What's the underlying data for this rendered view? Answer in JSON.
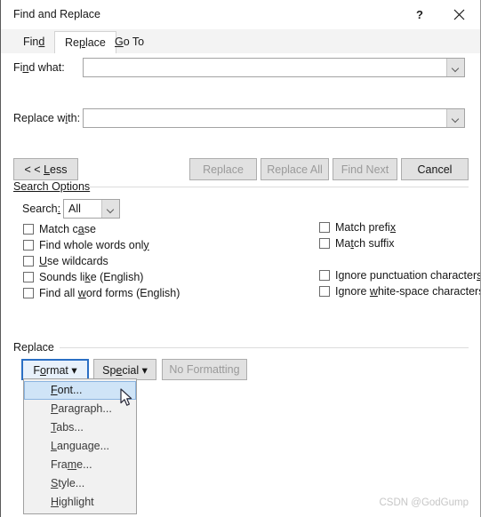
{
  "window": {
    "title": "Find and Replace",
    "help_label": "?",
    "close_label": "×"
  },
  "tabs": [
    {
      "label": "Find",
      "accel": "d",
      "active": false
    },
    {
      "label": "Replace",
      "accel": "p",
      "active": true
    },
    {
      "label": "Go To",
      "accel": "G",
      "active": false
    }
  ],
  "fields": {
    "find_what": {
      "label_pre": "Fi",
      "label_accel": "n",
      "label_post": "d what:",
      "value": "",
      "placeholder": ""
    },
    "replace_with": {
      "label_pre": "Replace w",
      "label_accel": "i",
      "label_post": "th:",
      "value": "",
      "placeholder": ""
    }
  },
  "buttons": {
    "less": "< < Less",
    "less_pre": "< < ",
    "less_accel": "L",
    "less_post": "ess",
    "replace": "Replace",
    "replace_all": "Replace All",
    "find_next": "Find Next",
    "cancel": "Cancel"
  },
  "search_options": {
    "group_label": "Search Options",
    "search_label_pre": "Search",
    "search_label_accel": ":",
    "search_value": "All",
    "left_checkboxes": [
      {
        "pre": "Match c",
        "accel": "a",
        "post": "se",
        "checked": false
      },
      {
        "pre": "Find whole words onl",
        "accel": "y",
        "post": "",
        "checked": false
      },
      {
        "pre": "",
        "accel": "U",
        "post": "se wildcards",
        "checked": false
      },
      {
        "pre": "Sounds li",
        "accel": "k",
        "post": "e (English)",
        "checked": false
      },
      {
        "pre": "Find all ",
        "accel": "w",
        "post": "ord forms (English)",
        "checked": false
      }
    ],
    "right_checkboxes": [
      {
        "pre": "Match prefi",
        "accel": "x",
        "post": "",
        "checked": false,
        "gap": false
      },
      {
        "pre": "Ma",
        "accel": "t",
        "post": "ch suffix",
        "checked": false,
        "gap": false
      },
      {
        "pre": "Ignore punctuation character",
        "accel": "s",
        "post": "",
        "checked": false,
        "gap": true
      },
      {
        "pre": "Ignore ",
        "accel": "w",
        "post": "hite-space characters",
        "checked": false,
        "gap": false
      }
    ]
  },
  "replace_section": {
    "group_label": "Replace",
    "format_pre": "F",
    "format_accel": "o",
    "format_post": "rmat",
    "format_caret": "▾",
    "special_pre": "Sp",
    "special_accel": "e",
    "special_post": "cial",
    "special_caret": "▾",
    "no_formatting": "No Formatting"
  },
  "format_menu": {
    "items": [
      {
        "pre": "",
        "accel": "F",
        "post": "ont...",
        "highlighted": true
      },
      {
        "pre": "",
        "accel": "P",
        "post": "aragraph...",
        "highlighted": false
      },
      {
        "pre": "",
        "accel": "T",
        "post": "abs...",
        "highlighted": false
      },
      {
        "pre": "",
        "accel": "L",
        "post": "anguage...",
        "highlighted": false
      },
      {
        "pre": "Fra",
        "accel": "m",
        "post": "e...",
        "highlighted": false
      },
      {
        "pre": "",
        "accel": "S",
        "post": "tyle...",
        "highlighted": false
      },
      {
        "pre": "",
        "accel": "H",
        "post": "ighlight",
        "highlighted": false
      }
    ]
  },
  "watermark": "CSDN @GodGump",
  "colors": {
    "accent_blue": "#2b6fc4",
    "menu_highlight": "#cfe4f7",
    "disabled_text": "#9a9a9a",
    "watermark_gray": "#c6c6c6"
  }
}
